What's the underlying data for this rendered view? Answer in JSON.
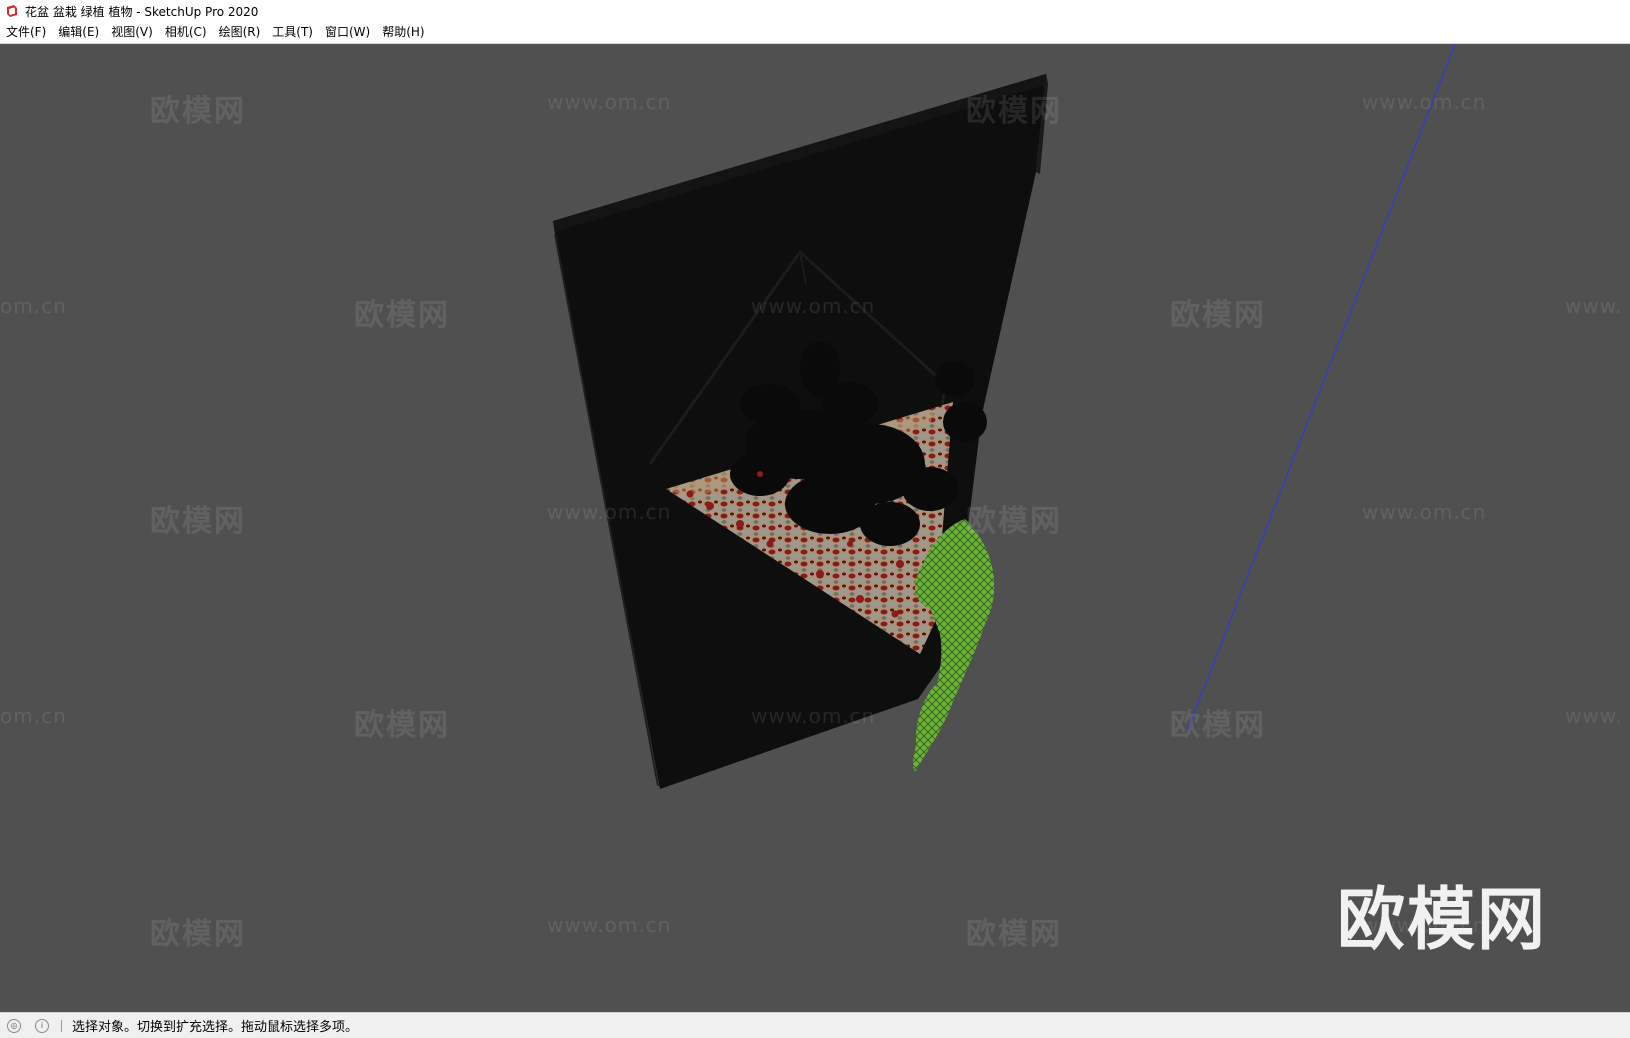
{
  "window": {
    "title": "花盆 盆栽 绿植 植物 - SketchUp Pro 2020",
    "app_icon": "sketchup-logo-icon"
  },
  "menu": [
    {
      "label": "文件(F)"
    },
    {
      "label": "编辑(E)"
    },
    {
      "label": "视图(V)"
    },
    {
      "label": "相机(C)"
    },
    {
      "label": "绘图(R)"
    },
    {
      "label": "工具(T)"
    },
    {
      "label": "窗口(W)"
    },
    {
      "label": "帮助(H)"
    }
  ],
  "watermark": {
    "brand": "欧模网",
    "url": "www.om.cn",
    "url_cropped_left": "om.cn",
    "url_cropped_right": "www."
  },
  "status": {
    "geo_icon": "geolocation-icon",
    "info_icon": "info-icon",
    "text": "选择对象。切换到扩充选择。拖动鼠标选择多项。"
  },
  "colors": {
    "viewport_bg": "#505050",
    "frame": "#0d0d0d",
    "soil": "#a8957a",
    "pebble_red": "#8b1a1a",
    "ivy_green": "#6bb13a",
    "axis_blue": "#2e3bd8"
  }
}
